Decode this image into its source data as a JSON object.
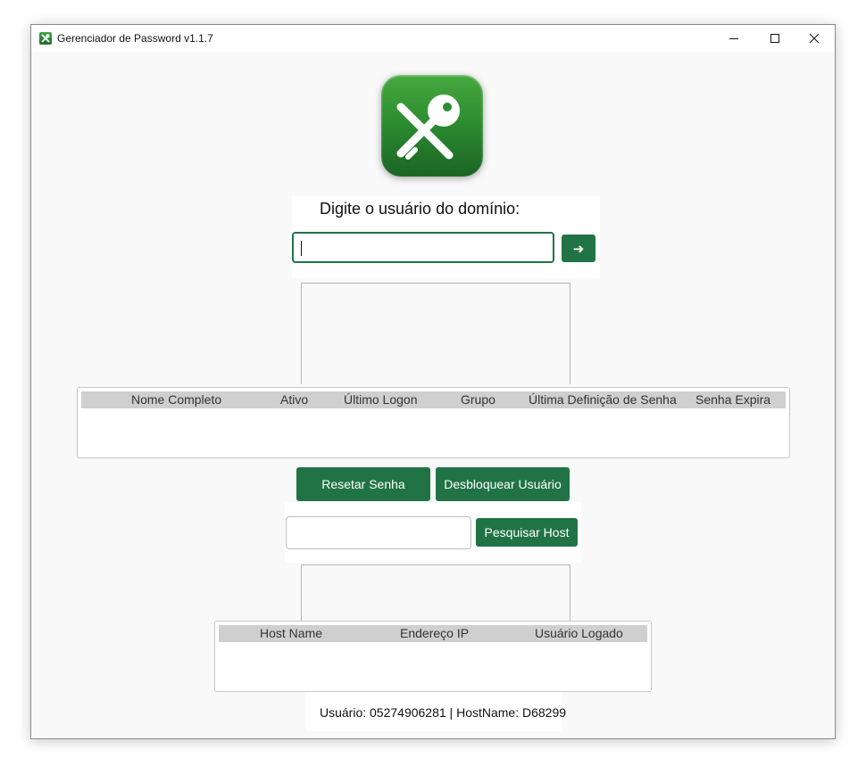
{
  "window": {
    "title": "Gerenciador de Password v1.1.7"
  },
  "search": {
    "prompt": "Digite o usuário do domínio:",
    "value": "",
    "go_label": "➜"
  },
  "user_table": {
    "columns": [
      "Nome Completo",
      "Ativo",
      "Último Logon",
      "Grupo",
      "Última Definição de Senha",
      "Senha Expira"
    ],
    "rows": []
  },
  "actions": {
    "reset": "Resetar Senha",
    "unlock": "Desbloquear Usuário"
  },
  "host_search": {
    "value": "",
    "button": "Pesquisar Host"
  },
  "host_table": {
    "columns": [
      "Host Name",
      "Endereço IP",
      "Usuário Logado"
    ],
    "rows": []
  },
  "status": "Usuário: 05274906281 | HostName: D68299",
  "colors": {
    "accent": "#217346",
    "header_bg": "#cfcfcf",
    "window_bg": "#f9f9f9"
  }
}
